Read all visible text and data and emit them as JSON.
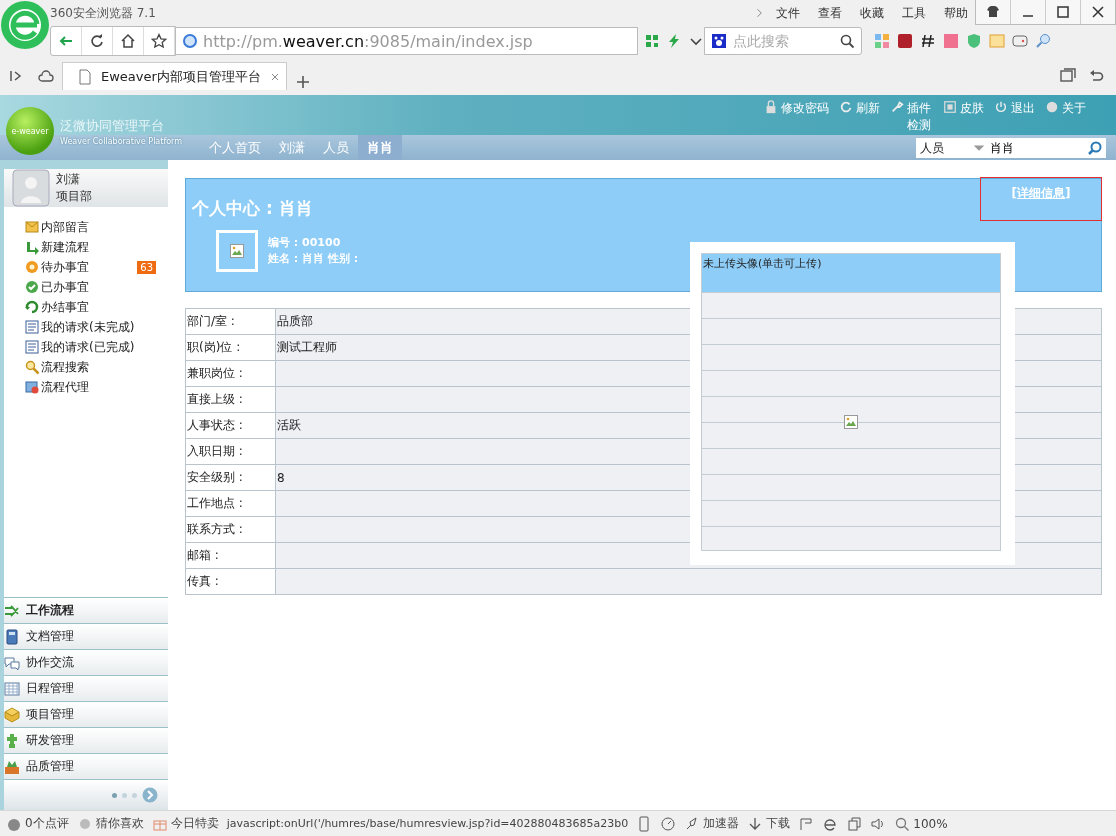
{
  "browser": {
    "title": "360安全浏览器 7.1",
    "menu": [
      "文件",
      "查看",
      "收藏",
      "工具",
      "帮助"
    ],
    "url_plain": "http://pm.",
    "url_domain": "weaver.cn",
    "url_rest": ":9085/main/index.jsp",
    "search_placeholder": "点此搜索",
    "tab_title": "Eweaver内部项目管理平台"
  },
  "app": {
    "logo_text": "e-weaver",
    "brand_title": "泛微协同管理平台",
    "brand_subtitle": "Weaver Collaborative Platform",
    "top_links": [
      "修改密码",
      "刷新",
      "插件检测",
      "皮肤",
      "退出",
      "关于"
    ],
    "nav_tabs": [
      {
        "label": "个人首页",
        "selected": false
      },
      {
        "label": "刘潇",
        "selected": false
      },
      {
        "label": "人员",
        "selected": false
      },
      {
        "label": "肖肖",
        "selected": true
      }
    ],
    "search": {
      "category": "人员",
      "value": "肖肖"
    }
  },
  "sidebar": {
    "user_name": "刘潇",
    "user_dept": "项目部",
    "items": [
      {
        "label": "内部留言"
      },
      {
        "label": "新建流程"
      },
      {
        "label": "待办事宜",
        "badge": "63"
      },
      {
        "label": "已办事宜"
      },
      {
        "label": "办结事宜"
      },
      {
        "label": "我的请求(未完成)"
      },
      {
        "label": "我的请求(已完成)"
      },
      {
        "label": "流程搜索"
      },
      {
        "label": "流程代理"
      }
    ],
    "modules": [
      {
        "label": "工作流程",
        "selected": true
      },
      {
        "label": "文档管理",
        "selected": false
      },
      {
        "label": "协作交流",
        "selected": false
      },
      {
        "label": "日程管理",
        "selected": false
      },
      {
        "label": "项目管理",
        "selected": false
      },
      {
        "label": "研发管理",
        "selected": false
      },
      {
        "label": "品质管理",
        "selected": false
      }
    ]
  },
  "main": {
    "title": "个人中心 : 肖肖",
    "detail_link": "[详细信息]",
    "number_line": "编号 : 00100",
    "name_line": "姓名 : 肖肖 性别 :",
    "fields": [
      {
        "label": "部门/室 :",
        "value": "品质部"
      },
      {
        "label": "职(岗)位 :",
        "value": "测试工程师"
      },
      {
        "label": "兼职岗位 :"
      },
      {
        "label": "直接上级 :"
      },
      {
        "label": "人事状态 :",
        "value": "活跃"
      },
      {
        "label": "入职日期 :"
      },
      {
        "label": "安全级别 :",
        "value": "8"
      },
      {
        "label": "工作地点 :"
      },
      {
        "label": "联系方式 :"
      },
      {
        "label": "邮箱 :"
      },
      {
        "label": "传真 :"
      }
    ],
    "popup": {
      "caption": "未上传头像(单击可上传)"
    }
  },
  "status_bar": {
    "left": [
      "0个点评",
      "猜你喜欢",
      "今日特卖"
    ],
    "url": "javascript:onUrl('/humres/base/humresview.jsp?id=402880483685a23b0",
    "right": [
      "加速器",
      "下载"
    ],
    "zoom": "100%"
  }
}
